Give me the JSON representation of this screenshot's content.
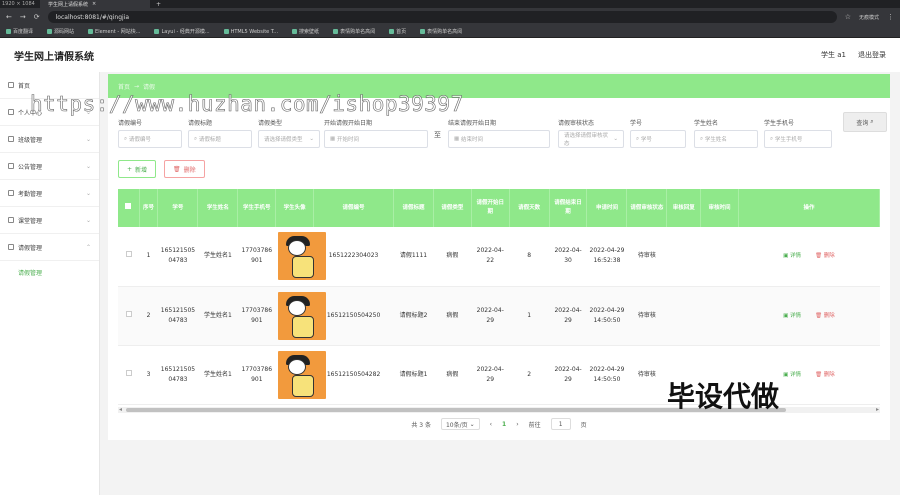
{
  "browser": {
    "screen_label": "1920 × 1084",
    "tab_title": "学生网上请假系统",
    "url": "localhost:8081/#/qingjia",
    "profile": "无痕模式",
    "bookmarks": [
      "百度翻译",
      "源码网站",
      "Element - 网站快...",
      "Layui - 经典开源模...",
      "HTML5 Website T...",
      "搜索壁纸",
      "表情购单名高阅",
      "首页",
      "表情购单名高阅"
    ]
  },
  "app": {
    "title": "学生网上请假系统",
    "user": "学生 a1",
    "logout": "退出登录"
  },
  "sidebar": {
    "items": [
      {
        "label": "首页"
      },
      {
        "label": "个人中心"
      },
      {
        "label": "班级管理"
      },
      {
        "label": "公告管理"
      },
      {
        "label": "考勤管理"
      },
      {
        "label": "课堂管理"
      },
      {
        "label": "请假管理"
      }
    ],
    "sub_item": "请假管理"
  },
  "breadcrumb": {
    "home": "首页",
    "sep": "→",
    "current": "请假"
  },
  "filters": {
    "fields": [
      {
        "label": "请假编号",
        "placeholder": "请假编号"
      },
      {
        "label": "请假标题",
        "placeholder": "请假标题"
      },
      {
        "label": "请假类型",
        "placeholder": "请选择请假类型"
      },
      {
        "label": "开始请假开始日期",
        "placeholder": "开始时间"
      },
      {
        "label": "结束请假开始日期",
        "placeholder": "结束时间"
      },
      {
        "label": "请假审核状态",
        "placeholder": "请选择请假审核状态"
      },
      {
        "label": "学号",
        "placeholder": "学号"
      },
      {
        "label": "学生姓名",
        "placeholder": "学生姓名"
      },
      {
        "label": "学生手机号",
        "placeholder": "学生手机号"
      }
    ],
    "range_sep": "至",
    "search_label": "查询"
  },
  "actions": {
    "add": "新增",
    "delete": "删除"
  },
  "table": {
    "headers": [
      "序号",
      "学号",
      "学生姓名",
      "学生手机号",
      "学生头像",
      "请假编号",
      "请假标题",
      "请假类型",
      "请假开始日期",
      "请假天数",
      "请假结束日期",
      "申请时间",
      "请假审核状态",
      "审核回复",
      "审核时间",
      "操作"
    ],
    "rows": [
      {
        "idx": "1",
        "sid": "16512150504783",
        "name": "学生姓名1",
        "phone": "17703786901",
        "leave_no": "1651222304023",
        "title": "请假1111",
        "type": "病假",
        "start": "2022-04-22",
        "days": "8",
        "end": "2022-04-30",
        "apply": "2022-04-29 16:52:38",
        "status": "待审核",
        "reply": "",
        "audit_time": ""
      },
      {
        "idx": "2",
        "sid": "16512150504783",
        "name": "学生姓名1",
        "phone": "17703786901",
        "leave_no": "16512150504250",
        "title": "请假标题2",
        "type": "病假",
        "start": "2022-04-29",
        "days": "1",
        "end": "2022-04-29",
        "apply": "2022-04-29 14:50:50",
        "status": "待审核",
        "reply": "",
        "audit_time": ""
      },
      {
        "idx": "3",
        "sid": "16512150504783",
        "name": "学生姓名1",
        "phone": "17703786901",
        "leave_no": "16512150504282",
        "title": "请假标题1",
        "type": "病假",
        "start": "2022-04-29",
        "days": "2",
        "end": "2022-04-29",
        "apply": "2022-04-29 14:50:50",
        "status": "待审核",
        "reply": "",
        "audit_time": ""
      }
    ],
    "detail_label": "详情",
    "delete_label": "删除"
  },
  "pagination": {
    "total": "共 3 条",
    "page_size": "10条/页",
    "current": "1",
    "goto": "前往",
    "goto_value": "1",
    "page_unit": "页"
  },
  "watermark": "https://www.huzhan.com/ishop39397",
  "stamp": "毕设代做",
  "colors": {
    "accent": "#8fe88a",
    "accent_text": "#4caf50",
    "danger": "#e06666"
  }
}
